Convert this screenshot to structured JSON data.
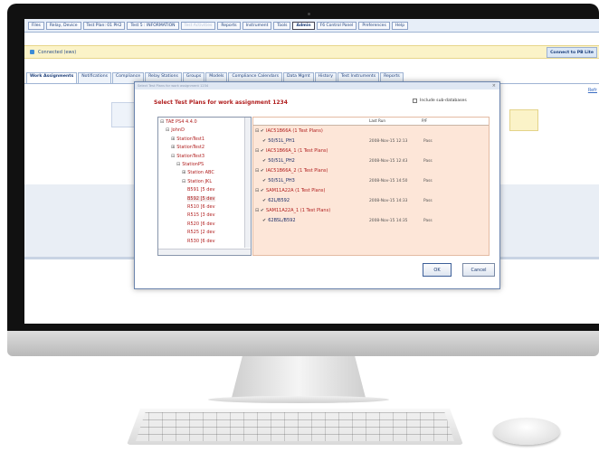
{
  "menubar": {
    "items": [
      {
        "label": "Files",
        "active": false
      },
      {
        "label": "Relay, Device",
        "active": false
      },
      {
        "label": "Test Plan: 01 PH2",
        "active": false
      },
      {
        "label": "Test 5 : INFORMATION",
        "active": false
      },
      {
        "label": "Test Activities",
        "active": false,
        "faint": true
      },
      {
        "label": "Reports",
        "active": false
      },
      {
        "label": "Instrument",
        "active": false
      },
      {
        "label": "Tools",
        "active": false
      },
      {
        "label": "Admin",
        "active": true
      },
      {
        "label": "F6 Control Panel",
        "active": false
      },
      {
        "label": "Preferences",
        "active": false
      },
      {
        "label": "Help",
        "active": false
      }
    ]
  },
  "status": {
    "text": "Connected (ews)",
    "connect_button": "Connect to PB Lite"
  },
  "subtabs": [
    {
      "label": "Work Assignments",
      "active": true
    },
    {
      "label": "Notifications"
    },
    {
      "label": "Compliance"
    },
    {
      "label": "Relay Stations"
    },
    {
      "label": "Groups"
    },
    {
      "label": "Models"
    },
    {
      "label": "Compliance Calendars"
    },
    {
      "label": "Data Mgmt"
    },
    {
      "label": "History"
    },
    {
      "label": "Test Instruments"
    },
    {
      "label": "Reports"
    }
  ],
  "right_link": "Refr",
  "dialog": {
    "titlebar": "Select Test Plans for work assignment 1234",
    "heading": "Select Test Plans for work assignment 1234",
    "include_label": "Include sub-databases",
    "tree": [
      {
        "label": "TAE PS4 4.4.0",
        "level": 0,
        "mark": "⊟"
      },
      {
        "label": "JohnD",
        "level": 1,
        "mark": "⊟"
      },
      {
        "label": "StationTest1",
        "level": 2,
        "mark": "⊞"
      },
      {
        "label": "StationTest2",
        "level": 2,
        "mark": "⊞"
      },
      {
        "label": "StationTest3",
        "level": 2,
        "mark": "⊟"
      },
      {
        "label": "StationPS",
        "level": 3,
        "mark": "⊟"
      },
      {
        "label": "Station ABC",
        "level": 4,
        "mark": "⊞"
      },
      {
        "label": "Station JKL",
        "level": 4,
        "mark": "⊟"
      },
      {
        "label": "B591    [5 dev",
        "level": 5,
        "mark": ""
      },
      {
        "label": "B592    [5 dev",
        "level": 5,
        "mark": "",
        "selected": true
      },
      {
        "label": "R510    [6 dev",
        "level": 5,
        "mark": ""
      },
      {
        "label": "R515    [3 dev",
        "level": 5,
        "mark": ""
      },
      {
        "label": "R520    [6 dev",
        "level": 5,
        "mark": ""
      },
      {
        "label": "R525    [2 dev",
        "level": 5,
        "mark": ""
      },
      {
        "label": "R530    [6 dev",
        "level": 5,
        "mark": ""
      }
    ],
    "plans_header": {
      "last_run": "Last Run",
      "pf": "P/F"
    },
    "plans": [
      {
        "label": "IAC51B66A (1 Test Plans)",
        "type": "group",
        "last_run": "",
        "pf": ""
      },
      {
        "label": "50/51L_PH1",
        "type": "child",
        "last_run": "2008-Nov-15 12:13",
        "pf": "Pass"
      },
      {
        "label": "IAC51B66A_1 (1 Test Plans)",
        "type": "group",
        "last_run": "",
        "pf": ""
      },
      {
        "label": "50/51L_PH2",
        "type": "child",
        "last_run": "2008-Nov-15 12:43",
        "pf": "Pass"
      },
      {
        "label": "IAC51B66A_2 (1 Test Plans)",
        "type": "group",
        "last_run": "",
        "pf": ""
      },
      {
        "label": "50/51L_PH3",
        "type": "child",
        "last_run": "2008-Nov-15 14:50",
        "pf": "Pass"
      },
      {
        "label": "SAM11A22A (1 Test Plans)",
        "type": "group",
        "last_run": "",
        "pf": ""
      },
      {
        "label": "62L/B592",
        "type": "child",
        "last_run": "2008-Nov-15 14:33",
        "pf": "Pass"
      },
      {
        "label": "SAM11A22A_1 (1 Test Plans)",
        "type": "group",
        "last_run": "",
        "pf": ""
      },
      {
        "label": "62BSL/B592",
        "type": "child",
        "last_run": "2008-Nov-15 14:35",
        "pf": "Pass"
      }
    ],
    "ok_label": "OK",
    "cancel_label": "Cancel"
  }
}
